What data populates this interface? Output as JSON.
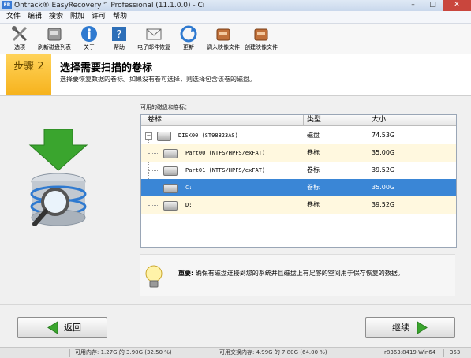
{
  "window": {
    "icon_text": "ER",
    "title": "Ontrack® EasyRecovery™ Professional (11.1.0.0) - Ci",
    "min": "–",
    "max": "□",
    "close": "✕"
  },
  "menu": [
    "文件",
    "编辑",
    "搜索",
    "附加",
    "许可",
    "帮助"
  ],
  "toolbar": [
    {
      "label": "选项",
      "icon": "tools-icon"
    },
    {
      "label": "刷新磁盘列表",
      "icon": "refresh-disk-icon"
    },
    {
      "label": "关于",
      "icon": "info-icon"
    },
    {
      "label": "帮助",
      "icon": "help-icon"
    },
    {
      "label": "电子邮件恢复",
      "icon": "email-icon"
    },
    {
      "label": "更新",
      "icon": "update-icon"
    },
    {
      "label": "调入映像文件",
      "icon": "load-image-icon"
    },
    {
      "label": "创建映像文件",
      "icon": "create-image-icon"
    }
  ],
  "step": {
    "label": "步骤 2",
    "title": "选择需要扫描的卷标",
    "description": "选择要恢复数据的卷标。如果没有卷可选择，则选择包含该卷的磁盘。"
  },
  "volumes": {
    "caption": "可用的磁盘和卷标：",
    "columns": [
      "卷标",
      "类型",
      "大小"
    ],
    "rows": [
      {
        "name": "DISK00 (ST98823AS)",
        "type": "磁盘",
        "size": "74.53G"
      },
      {
        "name": "Part00 (NTFS/HPFS/exFAT)",
        "type": "卷标",
        "size": "35.00G"
      },
      {
        "name": "Part01 (NTFS/HPFS/exFAT)",
        "type": "卷标",
        "size": "39.52G"
      },
      {
        "name": "C:",
        "type": "卷标",
        "size": "35.00G",
        "selected": true
      },
      {
        "name": "D:",
        "type": "卷标",
        "size": "39.52G"
      }
    ]
  },
  "notice": {
    "prefix": "重要:",
    "text": "确保有磁盘连接到您的系统并且磁盘上有足够的空间用于保存恢复的数据。"
  },
  "buttons": {
    "back": "返回",
    "next": "继续"
  },
  "status": {
    "memory": "可用内存: 1.27G 的 3.90G (32.50 %)",
    "swap": "可用交换内存: 4.99G 的 7.80G (64.00 %)",
    "build": "r8363:8419-Win64",
    "num": "353"
  },
  "colors": {
    "accent": "#f6b21c",
    "selection": "#3a86d6",
    "arrow": "#3aa52e"
  }
}
